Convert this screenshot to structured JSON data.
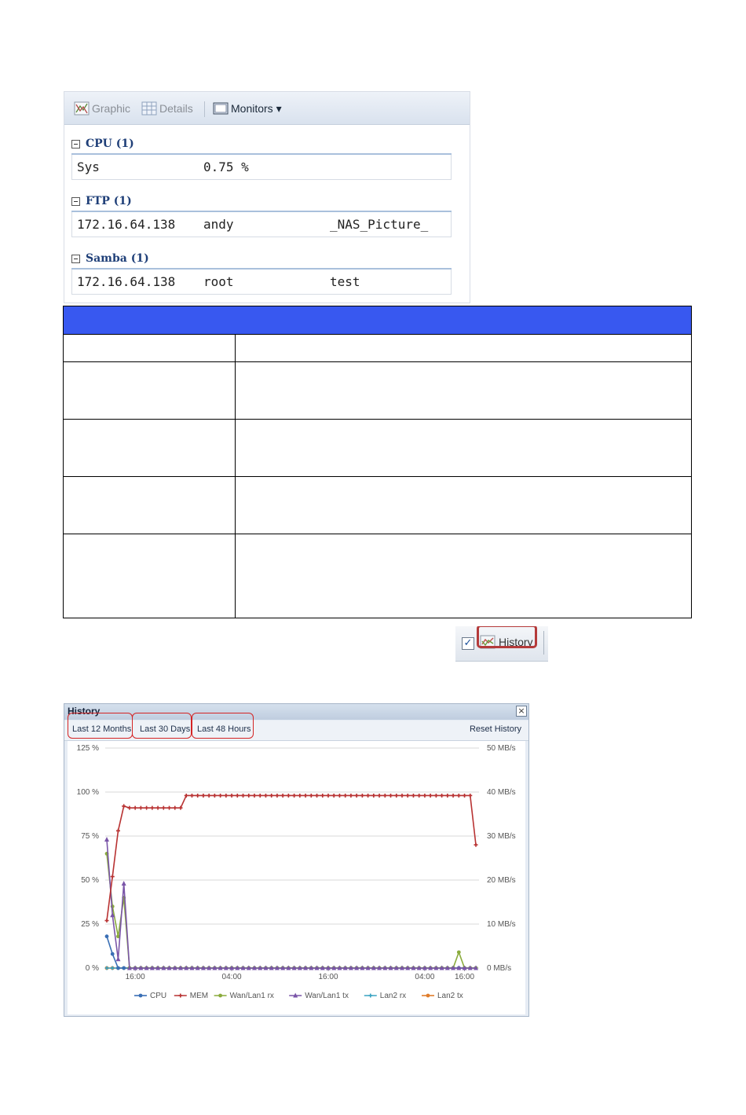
{
  "monitor_panel": {
    "toolbar": {
      "graphic_label": "Graphic",
      "details_label": "Details",
      "monitors_label": "Monitors ▾"
    },
    "groups": [
      {
        "title": "CPU (1)",
        "row": [
          "Sys",
          "0.75 %",
          ""
        ]
      },
      {
        "title": "FTP (1)",
        "row": [
          "172.16.64.138",
          "andy",
          "_NAS_Picture_"
        ]
      },
      {
        "title": "Samba (1)",
        "row": [
          "172.16.64.138",
          "root",
          "test"
        ]
      }
    ]
  },
  "history_button": {
    "label": "History",
    "checked": "✓"
  },
  "history_window": {
    "title": "History",
    "close": "×",
    "links": {
      "last_12_months": "Last 12 Months",
      "last_30_days": "Last 30 Days",
      "last_48_hours": "Last 48 Hours",
      "reset_history": "Reset History"
    }
  },
  "chart_data": {
    "type": "line",
    "x_tick_labels": [
      "16:00",
      "04:00",
      "16:00",
      "04:00",
      "16:00"
    ],
    "y_left_ticks": [
      "125 %",
      "100 %",
      "75 %",
      "50 %",
      "25 %",
      "0 %"
    ],
    "y_right_ticks": [
      "50 MB/s",
      "40 MB/s",
      "30 MB/s",
      "20 MB/s",
      "10 MB/s",
      "0 MB/s"
    ],
    "ylim_left": [
      0,
      125
    ],
    "ylim_right": [
      0,
      50
    ],
    "grid": true,
    "legend_position": "bottom",
    "series": [
      {
        "name": "CPU",
        "color": "#3a6fb5",
        "marker": "circle",
        "values": [
          18,
          8,
          0,
          0,
          0,
          0,
          0,
          0,
          0,
          0,
          0,
          0,
          0,
          0,
          0,
          0,
          0,
          0,
          0,
          0,
          0,
          0,
          0,
          0,
          0,
          0,
          0,
          0,
          0,
          0,
          0,
          0,
          0,
          0,
          0,
          0,
          0,
          0,
          0,
          0,
          0,
          0,
          0,
          0,
          0,
          0,
          0,
          0,
          0,
          0,
          0,
          0,
          0,
          0,
          0,
          0,
          0,
          0,
          0,
          0,
          0,
          0,
          0,
          0,
          0,
          0
        ]
      },
      {
        "name": "MEM",
        "color": "#b83232",
        "marker": "plus",
        "values": [
          27,
          52,
          78,
          92,
          91,
          91,
          91,
          91,
          91,
          91,
          91,
          91,
          91,
          91,
          98,
          98,
          98,
          98,
          98,
          98,
          98,
          98,
          98,
          98,
          98,
          98,
          98,
          98,
          98,
          98,
          98,
          98,
          98,
          98,
          98,
          98,
          98,
          98,
          98,
          98,
          98,
          98,
          98,
          98,
          98,
          98,
          98,
          98,
          98,
          98,
          98,
          98,
          98,
          98,
          98,
          98,
          98,
          98,
          98,
          98,
          98,
          98,
          98,
          98,
          98,
          70
        ]
      },
      {
        "name": "Wan/Lan1 rx",
        "color": "#8aab3c",
        "marker": "circle",
        "values": [
          65,
          35,
          18,
          40,
          0,
          0,
          0,
          0,
          0,
          0,
          0,
          0,
          0,
          0,
          0,
          0,
          0,
          0,
          0,
          0,
          0,
          0,
          0,
          0,
          0,
          0,
          0,
          0,
          0,
          0,
          0,
          0,
          0,
          0,
          0,
          0,
          0,
          0,
          0,
          0,
          0,
          0,
          0,
          0,
          0,
          0,
          0,
          0,
          0,
          0,
          0,
          0,
          0,
          0,
          0,
          0,
          0,
          0,
          0,
          0,
          0,
          0,
          9,
          0,
          0,
          0
        ]
      },
      {
        "name": "Wan/Lan1 tx",
        "color": "#7a55a8",
        "marker": "triangle",
        "values": [
          73,
          30,
          5,
          48,
          0,
          0,
          0,
          0,
          0,
          0,
          0,
          0,
          0,
          0,
          0,
          0,
          0,
          0,
          0,
          0,
          0,
          0,
          0,
          0,
          0,
          0,
          0,
          0,
          0,
          0,
          0,
          0,
          0,
          0,
          0,
          0,
          0,
          0,
          0,
          0,
          0,
          0,
          0,
          0,
          0,
          0,
          0,
          0,
          0,
          0,
          0,
          0,
          0,
          0,
          0,
          0,
          0,
          0,
          0,
          0,
          0,
          0,
          0,
          0,
          0,
          0
        ]
      },
      {
        "name": "Lan2 rx",
        "color": "#3aa3c2",
        "marker": "plus",
        "values": [
          0,
          0,
          0,
          0,
          0,
          0,
          0,
          0,
          0,
          0,
          0,
          0,
          0,
          0,
          0,
          0,
          0,
          0,
          0,
          0,
          0,
          0,
          0,
          0,
          0,
          0,
          0,
          0,
          0,
          0,
          0,
          0,
          0,
          0,
          0,
          0,
          0,
          0,
          0,
          0,
          0,
          0,
          0,
          0,
          0,
          0,
          0,
          0,
          0,
          0,
          0,
          0,
          0,
          0,
          0,
          0,
          0,
          0,
          0,
          0,
          0,
          0,
          0,
          0,
          0,
          0
        ]
      },
      {
        "name": "Lan2 tx",
        "color": "#e07d2c",
        "marker": "circle",
        "values": [
          0,
          0,
          0,
          0,
          0,
          0,
          0,
          0,
          0,
          0,
          0,
          0,
          0,
          0,
          0,
          0,
          0,
          0,
          0,
          0,
          0,
          0,
          0,
          0,
          0,
          0,
          0,
          0,
          0,
          0,
          0,
          0,
          0,
          0,
          0,
          0,
          0,
          0,
          0,
          0,
          0,
          0,
          0,
          0,
          0,
          0,
          0,
          0,
          0,
          0,
          0,
          0,
          0,
          0,
          0,
          0,
          0,
          0,
          0,
          0,
          0,
          0,
          0,
          0,
          0,
          0
        ]
      }
    ]
  }
}
